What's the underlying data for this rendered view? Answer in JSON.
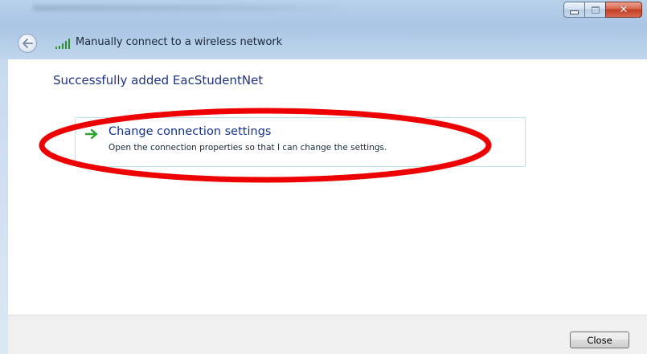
{
  "window": {
    "title": "Manually connect to a wireless network",
    "controls": {
      "minimize": "minimize",
      "maximize": "maximize",
      "close": "close"
    }
  },
  "nav": {
    "back_icon": "back-arrow-icon",
    "network_icon": "wireless-signal-icon"
  },
  "content": {
    "heading": "Successfully added EacStudentNet",
    "option": {
      "icon": "green-arrow-icon",
      "title": "Change connection settings",
      "description": "Open the connection properties so that I can change the settings."
    }
  },
  "footer": {
    "close_label": "Close"
  },
  "colors": {
    "heading": "#1e3287",
    "option_title": "#14318c",
    "annotation": "#ee0000",
    "arrow": "#2aa52a",
    "card_border": "#bde0ea"
  }
}
